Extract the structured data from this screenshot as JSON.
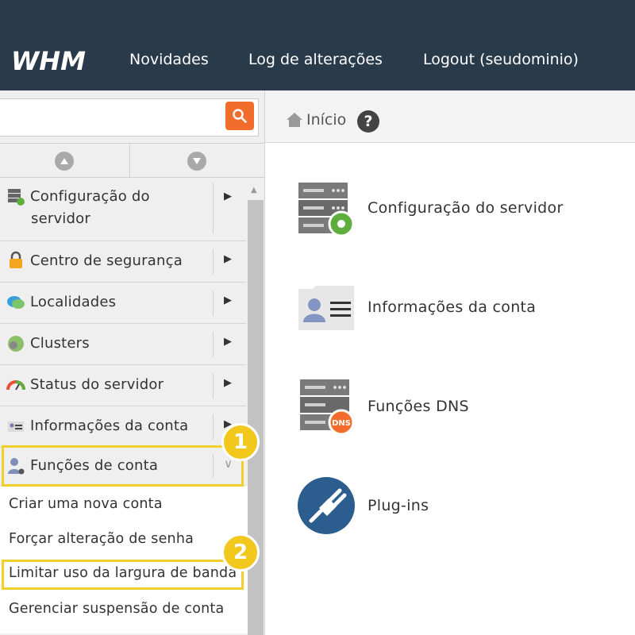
{
  "header": {
    "logo_text": "WHM",
    "nav": [
      "Novidades",
      "Log de alterações",
      "Logout (seudominio)"
    ]
  },
  "search": {
    "placeholder": ""
  },
  "breadcrumb": {
    "home_label": "Início",
    "help_label": "?"
  },
  "sidebar": {
    "items": [
      {
        "label_line1": "Configuração do",
        "label_line2": "servidor",
        "icon": "server-config-icon"
      },
      {
        "label": "Centro de segurança",
        "icon": "lock-icon"
      },
      {
        "label": "Localidades",
        "icon": "locale-icon"
      },
      {
        "label": "Clusters",
        "icon": "clusters-icon"
      },
      {
        "label": "Status do servidor",
        "icon": "gauge-icon"
      },
      {
        "label": "Informações da conta",
        "icon": "account-info-icon"
      },
      {
        "label": "Funções de conta",
        "icon": "account-functions-icon",
        "expanded": true
      }
    ],
    "subitems": [
      "Criar uma nova conta",
      "Forçar alteração de senha",
      "Limitar uso da largura de banda",
      "Gerenciar suspensão de conta"
    ]
  },
  "annotations": {
    "badge1": "1",
    "badge2": "2",
    "highlight_color": "#f2d02c"
  },
  "main": {
    "categories": [
      {
        "label": "Configuração do servidor",
        "icon": "server-gear-icon"
      },
      {
        "label": "Informações da conta",
        "icon": "id-card-icon"
      },
      {
        "label": "Funções DNS",
        "icon": "dns-server-icon",
        "badge": "DNS"
      },
      {
        "label": "Plug-ins",
        "icon": "plug-icon"
      }
    ]
  },
  "colors": {
    "header_bg": "#293a4a",
    "accent": "#f26d2b",
    "plug_blue": "#2c5d8f",
    "gear_green": "#5fae3d"
  }
}
